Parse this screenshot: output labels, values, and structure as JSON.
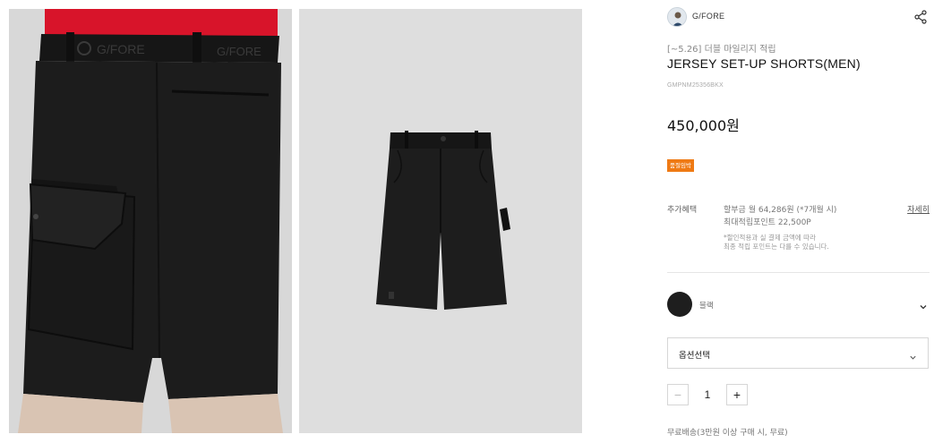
{
  "gallery": {
    "images": [
      {
        "name": "model-back-view",
        "waistband_text": "G/FORE"
      },
      {
        "name": "product-flat-view"
      }
    ]
  },
  "product": {
    "brand": "G/FORE",
    "promo_text": "[~5.26] 더블 마일리지 적립",
    "title": "JERSEY SET-UP SHORTS(MEN)",
    "sku": "GMPNM25356BKX",
    "price": "450,000원",
    "badge": "품절임박",
    "benefits": {
      "label": "추가혜택",
      "line1": "할부금 월 64,286원 (*7개월 시)",
      "line2": "최대적립포인트 22,500P",
      "note1": "*할인적용과 실 결제 금액에 따라",
      "note2": "최종 적립 포인트는 다를 수 있습니다.",
      "detail_link": "자세히"
    },
    "color": {
      "name": "블랙",
      "swatch": "#1e1e1e"
    },
    "option_select": {
      "label": "옵션선택"
    },
    "quantity": {
      "value": "1",
      "minus": "−",
      "plus": "+"
    },
    "shipping": "무료배송(3만원 이상 구매 시, 무료)"
  },
  "colors": {
    "badge": "#ef7a14",
    "text": "#111111",
    "muted": "#888888"
  }
}
